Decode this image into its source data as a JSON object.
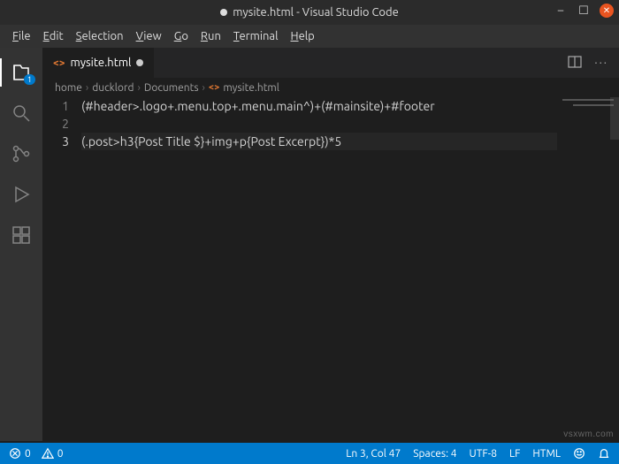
{
  "window": {
    "title": "mysite.html - Visual Studio Code",
    "modified": true
  },
  "menubar": [
    "File",
    "Edit",
    "Selection",
    "View",
    "Go",
    "Run",
    "Terminal",
    "Help"
  ],
  "activity": {
    "explorer_badge": "1"
  },
  "tab": {
    "filename": "mysite.html"
  },
  "breadcrumb": [
    "home",
    "ducklord",
    "Documents",
    "mysite.html"
  ],
  "code": {
    "lines": [
      "(#header>.logo+.menu.top+.menu.main^)+(#mainsite)+#footer",
      "",
      "(.post>h3{Post Title $}+img+p{Post Excerpt})*5"
    ],
    "active_line": 3,
    "active_col": 47
  },
  "status": {
    "errors": "0",
    "warnings": "0",
    "cursor": "Ln 3, Col 47",
    "spaces": "Spaces: 4",
    "encoding": "UTF-8",
    "eol": "LF",
    "lang": "HTML"
  },
  "watermark": "vsxwm.com"
}
